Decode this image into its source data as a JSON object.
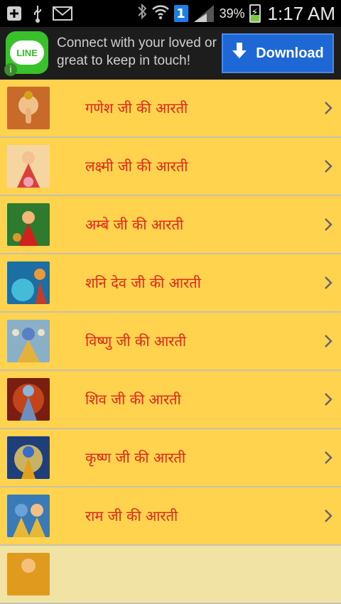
{
  "status_bar": {
    "battery": "39%",
    "time": "1:17 AM",
    "notification_count": "1",
    "icons": [
      "add-icon",
      "usb-icon",
      "mail-icon",
      "bluetooth-icon",
      "wifi-icon",
      "signal-icon",
      "battery-icon"
    ]
  },
  "ad": {
    "app_name": "LINE",
    "text_line1": "Connect with your loved or",
    "text_line2": "great to keep in touch!",
    "button_label": "Download",
    "colors": {
      "button": "#1e68d6",
      "logo": "#38c12a"
    }
  },
  "list": {
    "items": [
      {
        "label": "गणेश जी की आरती"
      },
      {
        "label": "लक्ष्मी जी की आरती"
      },
      {
        "label": "अम्बे जी की आरती"
      },
      {
        "label": "शनि देव जी की आरती"
      },
      {
        "label": "विष्णु जी की आरती"
      },
      {
        "label": "शिव जी की आरती"
      },
      {
        "label": "कृष्ण जी की आरती"
      },
      {
        "label": "राम जी की आरती"
      },
      {
        "label": ""
      }
    ],
    "colors": {
      "background": "#ffd34e",
      "label": "#e0251b"
    }
  }
}
